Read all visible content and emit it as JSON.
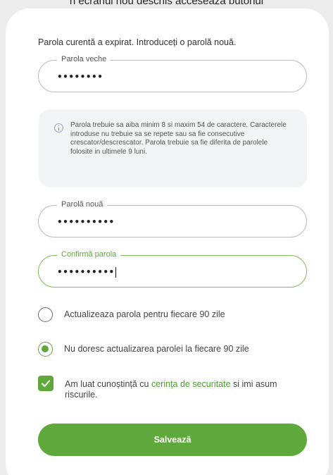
{
  "top_caption": "n ecranul nou deschis accesează butonul",
  "intro_text": "Parola curentă a expirat. Introduceți o parolă nouă.",
  "fields": {
    "old_password": {
      "label": "Parola veche",
      "value": "••••••••"
    },
    "new_password": {
      "label": "Parolă nouă",
      "value": "••••••••••"
    },
    "confirm_password": {
      "label": "Confirmă parola",
      "value": "••••••••••"
    }
  },
  "info": {
    "icon": "info-icon",
    "text": "Parola trebuie sa aiba minim 8 si maxim 54 de caractere. Caracterele introduse nu trebuie sa se repete sau sa fie consecutive crescator/descrescator. Parola trebuie sa fie diferita de parolele folosite in ultimele 9 luni."
  },
  "options": [
    {
      "label": "Actualizeaza parola pentru fiecare 90 zile",
      "checked": false
    },
    {
      "label": "Nu doresc actualizarea parolei la fiecare 90 zile",
      "checked": true
    }
  ],
  "consent": {
    "checked": true,
    "text_before": "Am luat cunoștință cu ",
    "link_text": "cerința de securitate",
    "text_after": " si imi asum riscurile."
  },
  "save_label": "Salvează",
  "colors": {
    "accent": "#5fa93c",
    "link": "#4a9e2a",
    "info_bg": "#f2f4f5"
  }
}
